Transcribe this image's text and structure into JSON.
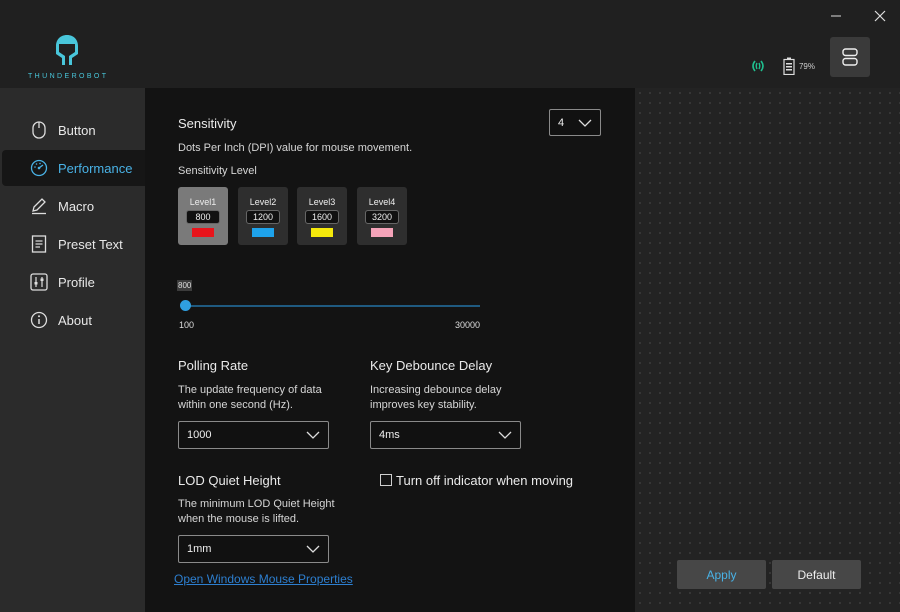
{
  "brand": {
    "name": "THUNDEROBOT",
    "accent": "#49c6da",
    "highlight": "#49b2e6"
  },
  "status": {
    "battery": "79%",
    "wireless_color": "#1fbf8f"
  },
  "window": {
    "minimize_icon": "minimize-icon",
    "close_icon": "close-icon"
  },
  "sidebar": {
    "items": [
      {
        "label": "Button",
        "icon": "mouse-icon"
      },
      {
        "label": "Performance",
        "icon": "gauge-icon"
      },
      {
        "label": "Macro",
        "icon": "pen-icon"
      },
      {
        "label": "Preset Text",
        "icon": "document-icon"
      },
      {
        "label": "Profile",
        "icon": "sliders-icon"
      },
      {
        "label": "About",
        "icon": "info-icon"
      }
    ],
    "active_index": 1
  },
  "sensitivity": {
    "title": "Sensitivity",
    "description": "Dots Per Inch (DPI) value for mouse movement.",
    "level_label": "Sensitivity Level",
    "levels_dropdown": "4",
    "levels": [
      {
        "name": "Level1",
        "dpi": "800",
        "color": "#e8141b"
      },
      {
        "name": "Level2",
        "dpi": "1200",
        "color": "#1ea3ec"
      },
      {
        "name": "Level3",
        "dpi": "1600",
        "color": "#f5e90b"
      },
      {
        "name": "Level4",
        "dpi": "3200",
        "color": "#f5a3b9"
      }
    ],
    "active_level": 0,
    "slider": {
      "value": "800",
      "min": "100",
      "max": "30000"
    }
  },
  "polling": {
    "title": "Polling Rate",
    "description_1": "The update frequency of data",
    "description_2": "within one second (Hz).",
    "value": "1000"
  },
  "debounce": {
    "title": "Key Debounce Delay",
    "description_1": "Increasing debounce delay",
    "description_2": "improves key stability.",
    "value": "4ms"
  },
  "lod": {
    "title": "LOD Quiet Height",
    "description_1": "The minimum LOD Quiet Height",
    "description_2": "when the mouse is lifted.",
    "value": "1mm"
  },
  "indicator": {
    "label": "Turn off indicator when moving",
    "checked": false
  },
  "link": "Open Windows Mouse Properties",
  "actions": {
    "apply": "Apply",
    "default": "Default"
  }
}
